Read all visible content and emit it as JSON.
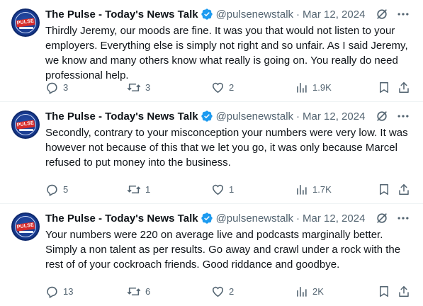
{
  "colors": {
    "text": "#0f1419",
    "secondary": "#536471",
    "verified": "#1d9bf0",
    "divider": "#eff3f4"
  },
  "tweets": [
    {
      "author": "The Pulse - Today's News Talk",
      "handle": "@pulsenewstalk",
      "separator": "·",
      "date": "Mar 12, 2024",
      "avatar_text": "PULSE",
      "text": "Thirdly Jeremy, our moods are fine. It was you that would not listen to your employers. Everything else is simply not right and so unfair. As I said Jeremy, we know and many others know what really is going on. You really do need professional help.",
      "replies": "3",
      "reposts": "3",
      "likes": "2",
      "views": "1.9K"
    },
    {
      "author": "The Pulse - Today's News Talk",
      "handle": "@pulsenewstalk",
      "separator": "·",
      "date": "Mar 12, 2024",
      "avatar_text": "PULSE",
      "text": "Secondly, contrary to your misconception your numbers were very low. It was however not because of this that we let you go, it was only because Marcel refused to put money into the business.",
      "replies": "5",
      "reposts": "1",
      "likes": "1",
      "views": "1.7K"
    },
    {
      "author": "The Pulse - Today's News Talk",
      "handle": "@pulsenewstalk",
      "separator": "·",
      "date": "Mar 12, 2024",
      "avatar_text": "PULSE",
      "text": "Your numbers were 220 on average live and podcasts marginally better. Simply a non talent as per results. Go away and crawl under a rock with the rest of of your cockroach friends. Good riddance and goodbye.",
      "replies": "13",
      "reposts": "6",
      "likes": "2",
      "views": "2K"
    }
  ]
}
